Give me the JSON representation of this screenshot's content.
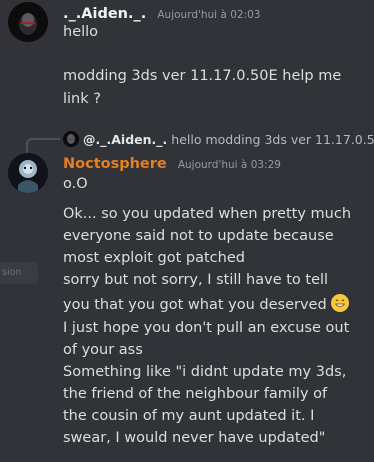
{
  "message1": {
    "author": "._.Aiden._.",
    "timestamp": "Aujourd'hui à 02:03",
    "lines": [
      "hello",
      "modding 3ds ver 11.17.0.50E help me",
      "link ?"
    ]
  },
  "reply_preview": {
    "author": "@._.Aiden._.",
    "text": "hello modding 3ds ver 11.17.0.5"
  },
  "message2": {
    "author": "Noctosphere",
    "author_color": "#e67e22",
    "timestamp": "Aujourd'hui à 03:29",
    "lines": [
      "o.O",
      "Ok... so you updated when pretty much",
      "everyone said not to update because",
      "most exploit got patched",
      "sorry but not sorry, I still have to tell",
      "you that you got what you deserved",
      "I just hope you don't pull an excuse out",
      "of your ass",
      "Something like \"i didnt update my 3ds,",
      "the friend of the neighbour family of",
      "the cousin of my aunt updated it. I",
      "swear, I would never have updated\""
    ],
    "emoji": "grinning-face-emoji"
  },
  "side_chip": {
    "text": "sion"
  }
}
